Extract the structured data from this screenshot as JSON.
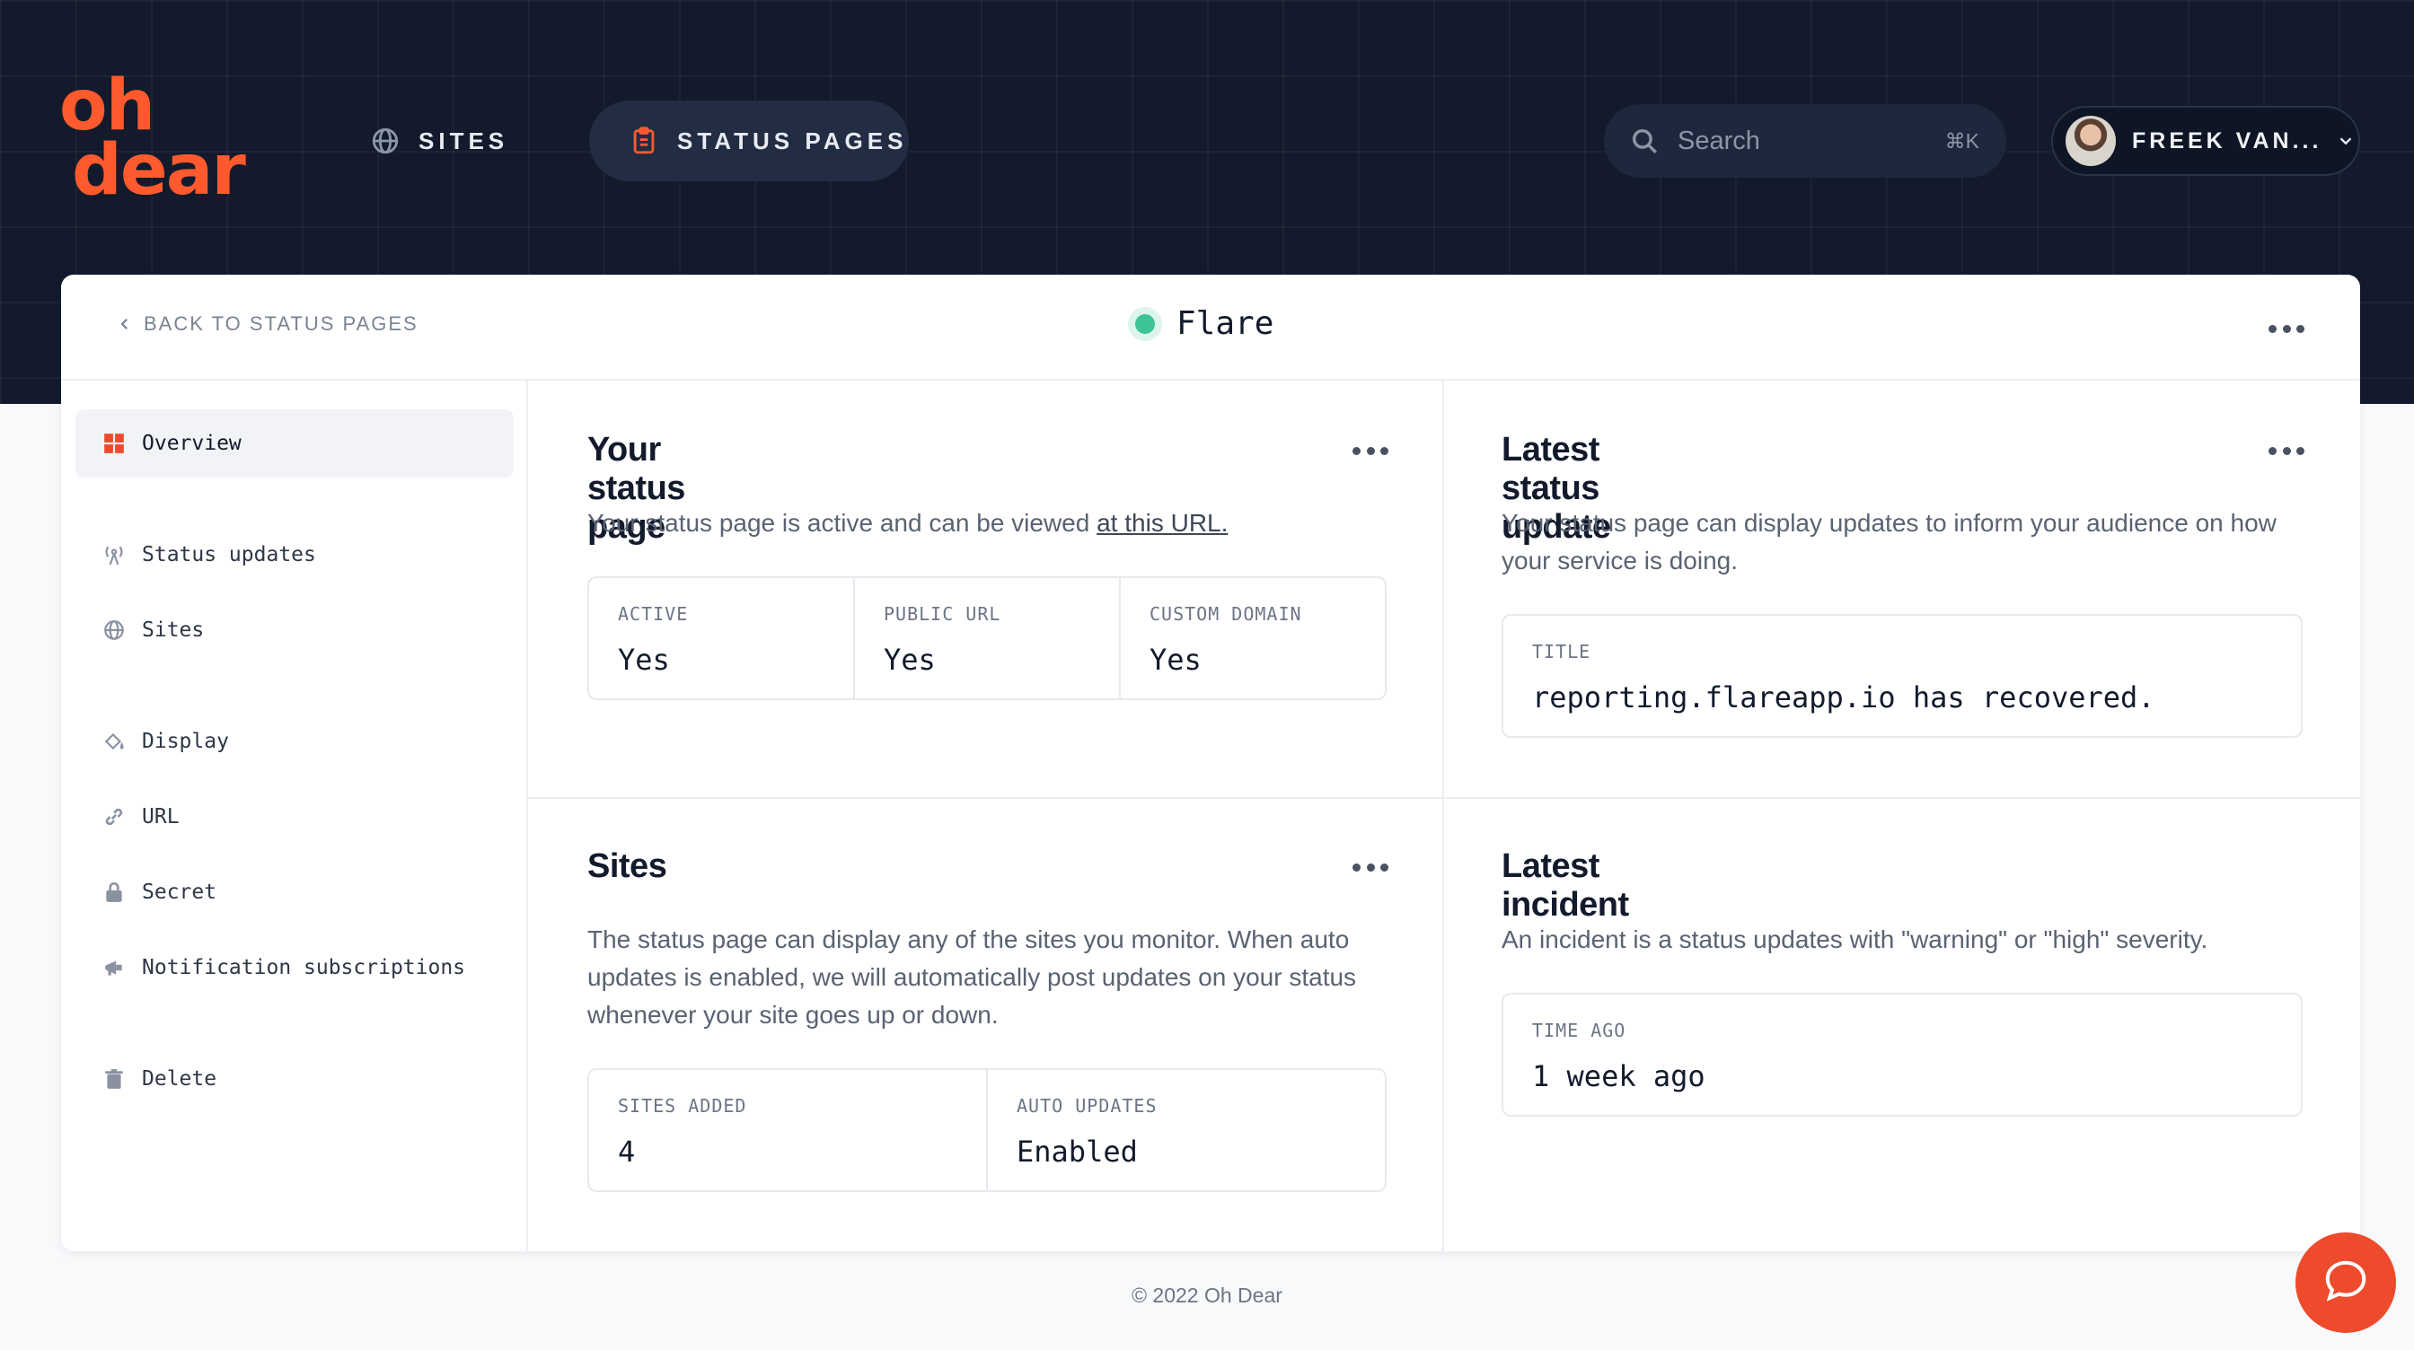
{
  "brand": {
    "line1": "oh",
    "line2": "dear",
    "color": "#ff5a2e"
  },
  "nav": {
    "sites": "SITES",
    "status_pages": "STATUS PAGES"
  },
  "search": {
    "placeholder": "Search",
    "shortcut": "⌘K"
  },
  "user": {
    "name": "FREEK VAN..."
  },
  "header": {
    "back_label": "BACK TO STATUS PAGES",
    "title": "Flare",
    "status_color": "#3ec394"
  },
  "sidebar": {
    "items": [
      {
        "label": "Overview",
        "icon": "grid-icon"
      },
      {
        "label": "Status updates",
        "icon": "broadcast-icon"
      },
      {
        "label": "Sites",
        "icon": "globe-icon"
      },
      {
        "label": "Display",
        "icon": "paint-bucket-icon"
      },
      {
        "label": "URL",
        "icon": "link-icon"
      },
      {
        "label": "Secret",
        "icon": "lock-icon"
      },
      {
        "label": "Notification subscriptions",
        "icon": "megaphone-icon"
      },
      {
        "label": "Delete",
        "icon": "trash-icon"
      }
    ]
  },
  "status_page": {
    "title": "Your status page",
    "desc_prefix": "Your status page is active and can be viewed ",
    "desc_link": "at this URL.",
    "stats": [
      {
        "label": "ACTIVE",
        "value": "Yes"
      },
      {
        "label": "PUBLIC URL",
        "value": "Yes"
      },
      {
        "label": "CUSTOM DOMAIN",
        "value": "Yes"
      }
    ]
  },
  "latest_update": {
    "title": "Latest status update",
    "desc": "Your status page can display updates to inform your audience on how your service is doing.",
    "stat_label": "TITLE",
    "stat_value": "reporting.flareapp.io has recovered."
  },
  "sites": {
    "title": "Sites",
    "desc": "The status page can display any of the sites you monitor. When auto updates is enabled, we will automatically post updates on your status whenever your site goes up or down.",
    "stats": [
      {
        "label": "SITES ADDED",
        "value": "4"
      },
      {
        "label": "AUTO UPDATES",
        "value": "Enabled"
      }
    ]
  },
  "latest_incident": {
    "title": "Latest incident",
    "desc": "An incident is a status updates with \"warning\" or \"high\" severity.",
    "stat_label": "TIME AGO",
    "stat_value": "1 week ago"
  },
  "footer": {
    "text": "© 2022 Oh Dear"
  }
}
